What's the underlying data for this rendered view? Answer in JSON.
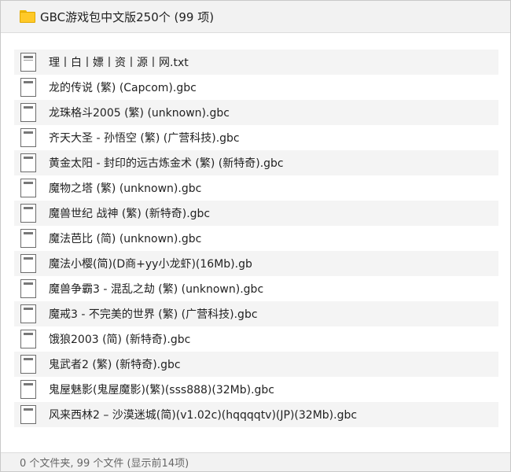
{
  "window": {
    "title": "GBC游戏包中文版250个 (99 项)",
    "title_icon": "folder-icon"
  },
  "files": [
    {
      "name": "理丨白丨嫖丨资丨源丨网.txt",
      "icon": "text-file-icon"
    },
    {
      "name": "龙的传说 (繁) (Capcom).gbc",
      "icon": "file-icon"
    },
    {
      "name": "龙珠格斗2005 (繁) (unknown).gbc",
      "icon": "file-icon"
    },
    {
      "name": "齐天大圣 - 孙悟空 (繁) (广营科技).gbc",
      "icon": "file-icon"
    },
    {
      "name": "黄金太阳 - 封印的远古炼金术 (繁) (新特奇).gbc",
      "icon": "file-icon"
    },
    {
      "name": "魔物之塔 (繁) (unknown).gbc",
      "icon": "file-icon"
    },
    {
      "name": "魔兽世纪 战神 (繁) (新特奇).gbc",
      "icon": "file-icon"
    },
    {
      "name": "魔法芭比 (简) (unknown).gbc",
      "icon": "file-icon"
    },
    {
      "name": "魔法小樱(简)(D商+yy小龙虾)(16Mb).gb",
      "icon": "file-icon"
    },
    {
      "name": "魔兽争霸3 - 混乱之劫 (繁) (unknown).gbc",
      "icon": "file-icon"
    },
    {
      "name": "魔戒3 - 不完美的世界 (繁) (广营科技).gbc",
      "icon": "file-icon"
    },
    {
      "name": "饿狼2003 (简) (新特奇).gbc",
      "icon": "file-icon"
    },
    {
      "name": "鬼武者2 (繁) (新特奇).gbc",
      "icon": "file-icon"
    },
    {
      "name": "鬼屋魅影(鬼屋魔影)(繁)(sss888)(32Mb).gbc",
      "icon": "file-icon"
    },
    {
      "name": "风来西林2 – 沙漠迷城(简)(v1.02c)(hqqqqtv)(JP)(32Mb).gbc",
      "icon": "file-icon"
    }
  ],
  "status": {
    "text": "0 个文件夹, 99 个文件 (显示前14项)"
  },
  "colors": {
    "titlebar_bg": "#f2f2f2",
    "row_stripe": "#f4f4f4",
    "folder": "#ffc928",
    "status_text": "#666666"
  }
}
